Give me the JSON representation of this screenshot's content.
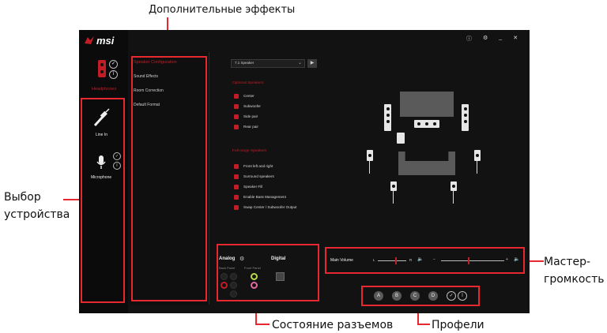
{
  "annotations": {
    "additional_effects": "Дополнительные эффекты",
    "device_select_1": "Выбор",
    "device_select_2": "устройства",
    "master_volume_1": "Мастер-",
    "master_volume_2": "громкость",
    "jack_status": "Состояние разъемов",
    "profiles": "Профели"
  },
  "app": {
    "brand": "msi",
    "window_controls": [
      "ⓘ",
      "⚙",
      "_",
      "✕"
    ],
    "devices": [
      {
        "label": "Headphones"
      },
      {
        "label": "Line In"
      },
      {
        "label": "Microphone"
      }
    ],
    "menu": [
      "Speaker Configuration",
      "Sound Effects",
      "Room Correction",
      "Default Format"
    ],
    "speaker_select": "7.1 Speaker",
    "optional_speakers_title": "Optional Speakers",
    "optional_speakers": [
      "Center",
      "Subwoofer",
      "Side pair",
      "Rear pair"
    ],
    "full_range_title": "Full-range Speakers",
    "full_range": [
      "Front left and right",
      "Surround speakers",
      "Speaker Fill",
      "Enable Bass Management",
      "Swap Center / Subwoofer Output"
    ],
    "analog_label": "Analog",
    "digital_label": "Digital",
    "back_panel": "Back Panel",
    "front_panel": "Front Panel",
    "main_volume": "Main Volume",
    "vol_left": "L",
    "vol_right": "R",
    "vol_minus": "−",
    "vol_plus": "+",
    "profiles": [
      "A",
      "B",
      "C",
      "D"
    ],
    "colors": {
      "accent": "#c21d26",
      "annotation": "#e8282f",
      "bg": "#121212"
    }
  }
}
